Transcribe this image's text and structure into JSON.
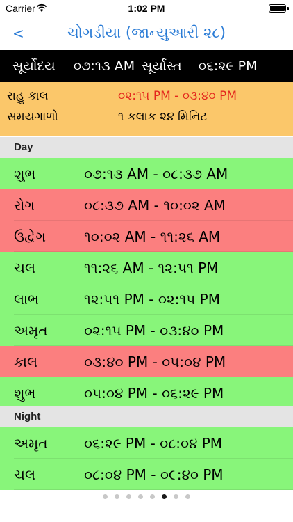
{
  "status_bar": {
    "carrier": "Carrier",
    "time": "1:02 PM"
  },
  "nav": {
    "back_label": "<",
    "title": "ચોગડીયા (જાન્યુઆરી ૨૮)"
  },
  "sun": {
    "sunrise_label": "સૂર્યોદય",
    "sunrise_time": "૦૭:૧૩ AM",
    "sunset_label": "સૂર્યાસ્ત",
    "sunset_time": "૦૬:૨૯ PM"
  },
  "info": {
    "rahu_label": "રાહુ કાલ",
    "rahu_value": "૦૨:૧૫ PM - ૦૩:૪૦ PM",
    "duration_label": "સમયગાળો",
    "duration_value": "૧ કલાક ૨૪ મિનિટ"
  },
  "colors": {
    "good": "#88f57a",
    "bad": "#fb7f7f",
    "info": "#fbc76a",
    "accent": "#2b7cd6",
    "rahu": "#e3271d"
  },
  "sections": {
    "day_label": "Day",
    "night_label": "Night",
    "day": [
      {
        "name": "શુભ",
        "time": "૦૭:૧૩ AM - ૦૮:૩૭ AM",
        "color": "#88f57a"
      },
      {
        "name": "રોગ",
        "time": "૦૮:૩૭ AM - ૧૦:૦૨ AM",
        "color": "#fb7f7f"
      },
      {
        "name": "ઉદ્વેગ",
        "time": "૧૦:૦૨ AM - ૧૧:૨૬ AM",
        "color": "#fb7f7f"
      },
      {
        "name": "ચલ",
        "time": "૧૧:૨૬ AM - ૧૨:૫૧ PM",
        "color": "#88f57a"
      },
      {
        "name": "લાભ",
        "time": "૧૨:૫૧ PM - ૦૨:૧૫ PM",
        "color": "#88f57a"
      },
      {
        "name": "અમૃત",
        "time": "૦૨:૧૫ PM - ૦૩:૪૦ PM",
        "color": "#88f57a"
      },
      {
        "name": "કાલ",
        "time": "૦૩:૪૦ PM - ૦૫:૦૪ PM",
        "color": "#fb7f7f"
      },
      {
        "name": "શુભ",
        "time": "૦૫:૦૪ PM - ૦૬:૨૯ PM",
        "color": "#88f57a"
      }
    ],
    "night": [
      {
        "name": "અમૃત",
        "time": "૦૬:૨૯ PM - ૦૮:૦૪ PM",
        "color": "#88f57a"
      },
      {
        "name": "ચલ",
        "time": "૦૮:૦૪ PM - ૦૯:૪૦ PM",
        "color": "#88f57a"
      }
    ]
  },
  "pager": {
    "count": 8,
    "active": 5
  }
}
